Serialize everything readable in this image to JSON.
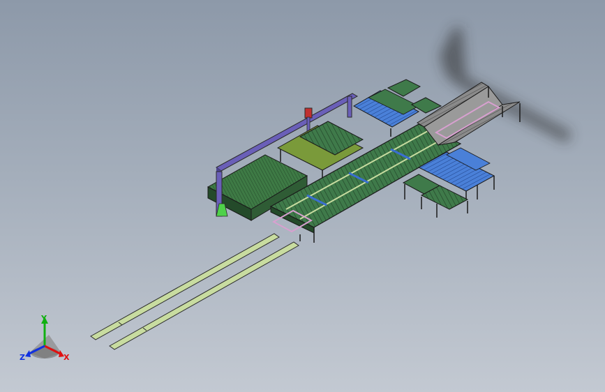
{
  "viewport": {
    "model_name": "",
    "background_top": "#8d99a9",
    "background_bottom": "#c3c9d2"
  },
  "triad": {
    "x_label": "X",
    "y_label": "Y",
    "z_label": "Z",
    "x_color": "#e01010",
    "y_color": "#10b010",
    "z_color": "#1030e0"
  },
  "colors": {
    "gantry": "#6a5fb8",
    "frame": "#2a2a2a",
    "table_green": "#3f7a4a",
    "rail": "#c8dca0",
    "roller_blue": "#3a6fd0",
    "conveyor_gray": "#7a7a7a",
    "outline_pink": "#d8a0d0"
  }
}
